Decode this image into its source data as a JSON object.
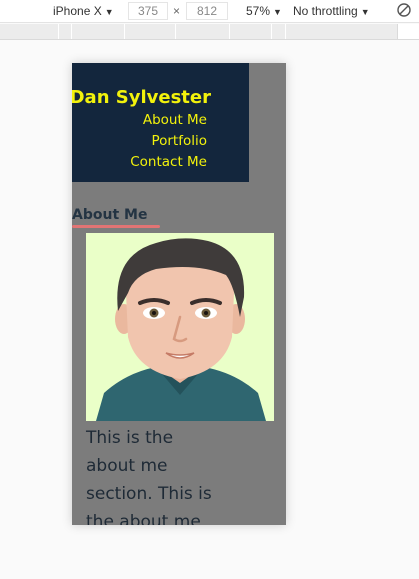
{
  "devtools": {
    "device": "iPhone X",
    "device_caret": "▼",
    "width": "375",
    "times": "×",
    "height": "812",
    "zoom": "57%",
    "zoom_caret": "▼",
    "throttling": "No throttling",
    "throttling_caret": "▼",
    "rotate_icon": "rotate-icon"
  },
  "site": {
    "name": "Dan Sylvester",
    "nav": [
      "About Me",
      "Portfolio",
      "Contact Me"
    ],
    "section_heading": "About Me",
    "about_text": "This is the about me section. This is the about me section."
  },
  "colors": {
    "header_bg": "#13263d",
    "accent_yellow": "#f2f20c",
    "underline": "#e27474",
    "viewport_bg": "#7c7c7c",
    "avatar_bg": "#eaffc8"
  }
}
